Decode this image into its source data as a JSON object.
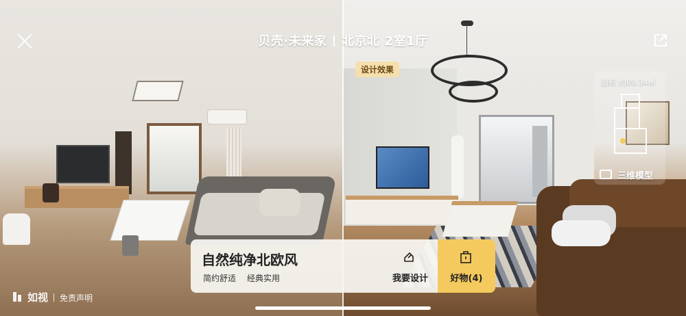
{
  "header": {
    "title_brand": "贝壳·未来家",
    "title_listing": "北京北 2室1厅"
  },
  "scene": {
    "design_tag": "设计效果",
    "area_label": "面积",
    "area_value": "约89.34㎡",
    "model_button_label": "三维模型"
  },
  "panel": {
    "style_title": "自然纯净北欧风",
    "tags": [
      "简约舒适",
      "经典实用"
    ],
    "design_button_label": "我要设计",
    "goods_button_label": "好物(4)",
    "accent_color": "#f4c95d"
  },
  "footer": {
    "brand_name": "如视",
    "disclaimer": "免责声明"
  },
  "icons": [
    "close-icon",
    "share-icon",
    "edit-icon",
    "bag-icon",
    "cube-icon",
    "logo-icon"
  ]
}
